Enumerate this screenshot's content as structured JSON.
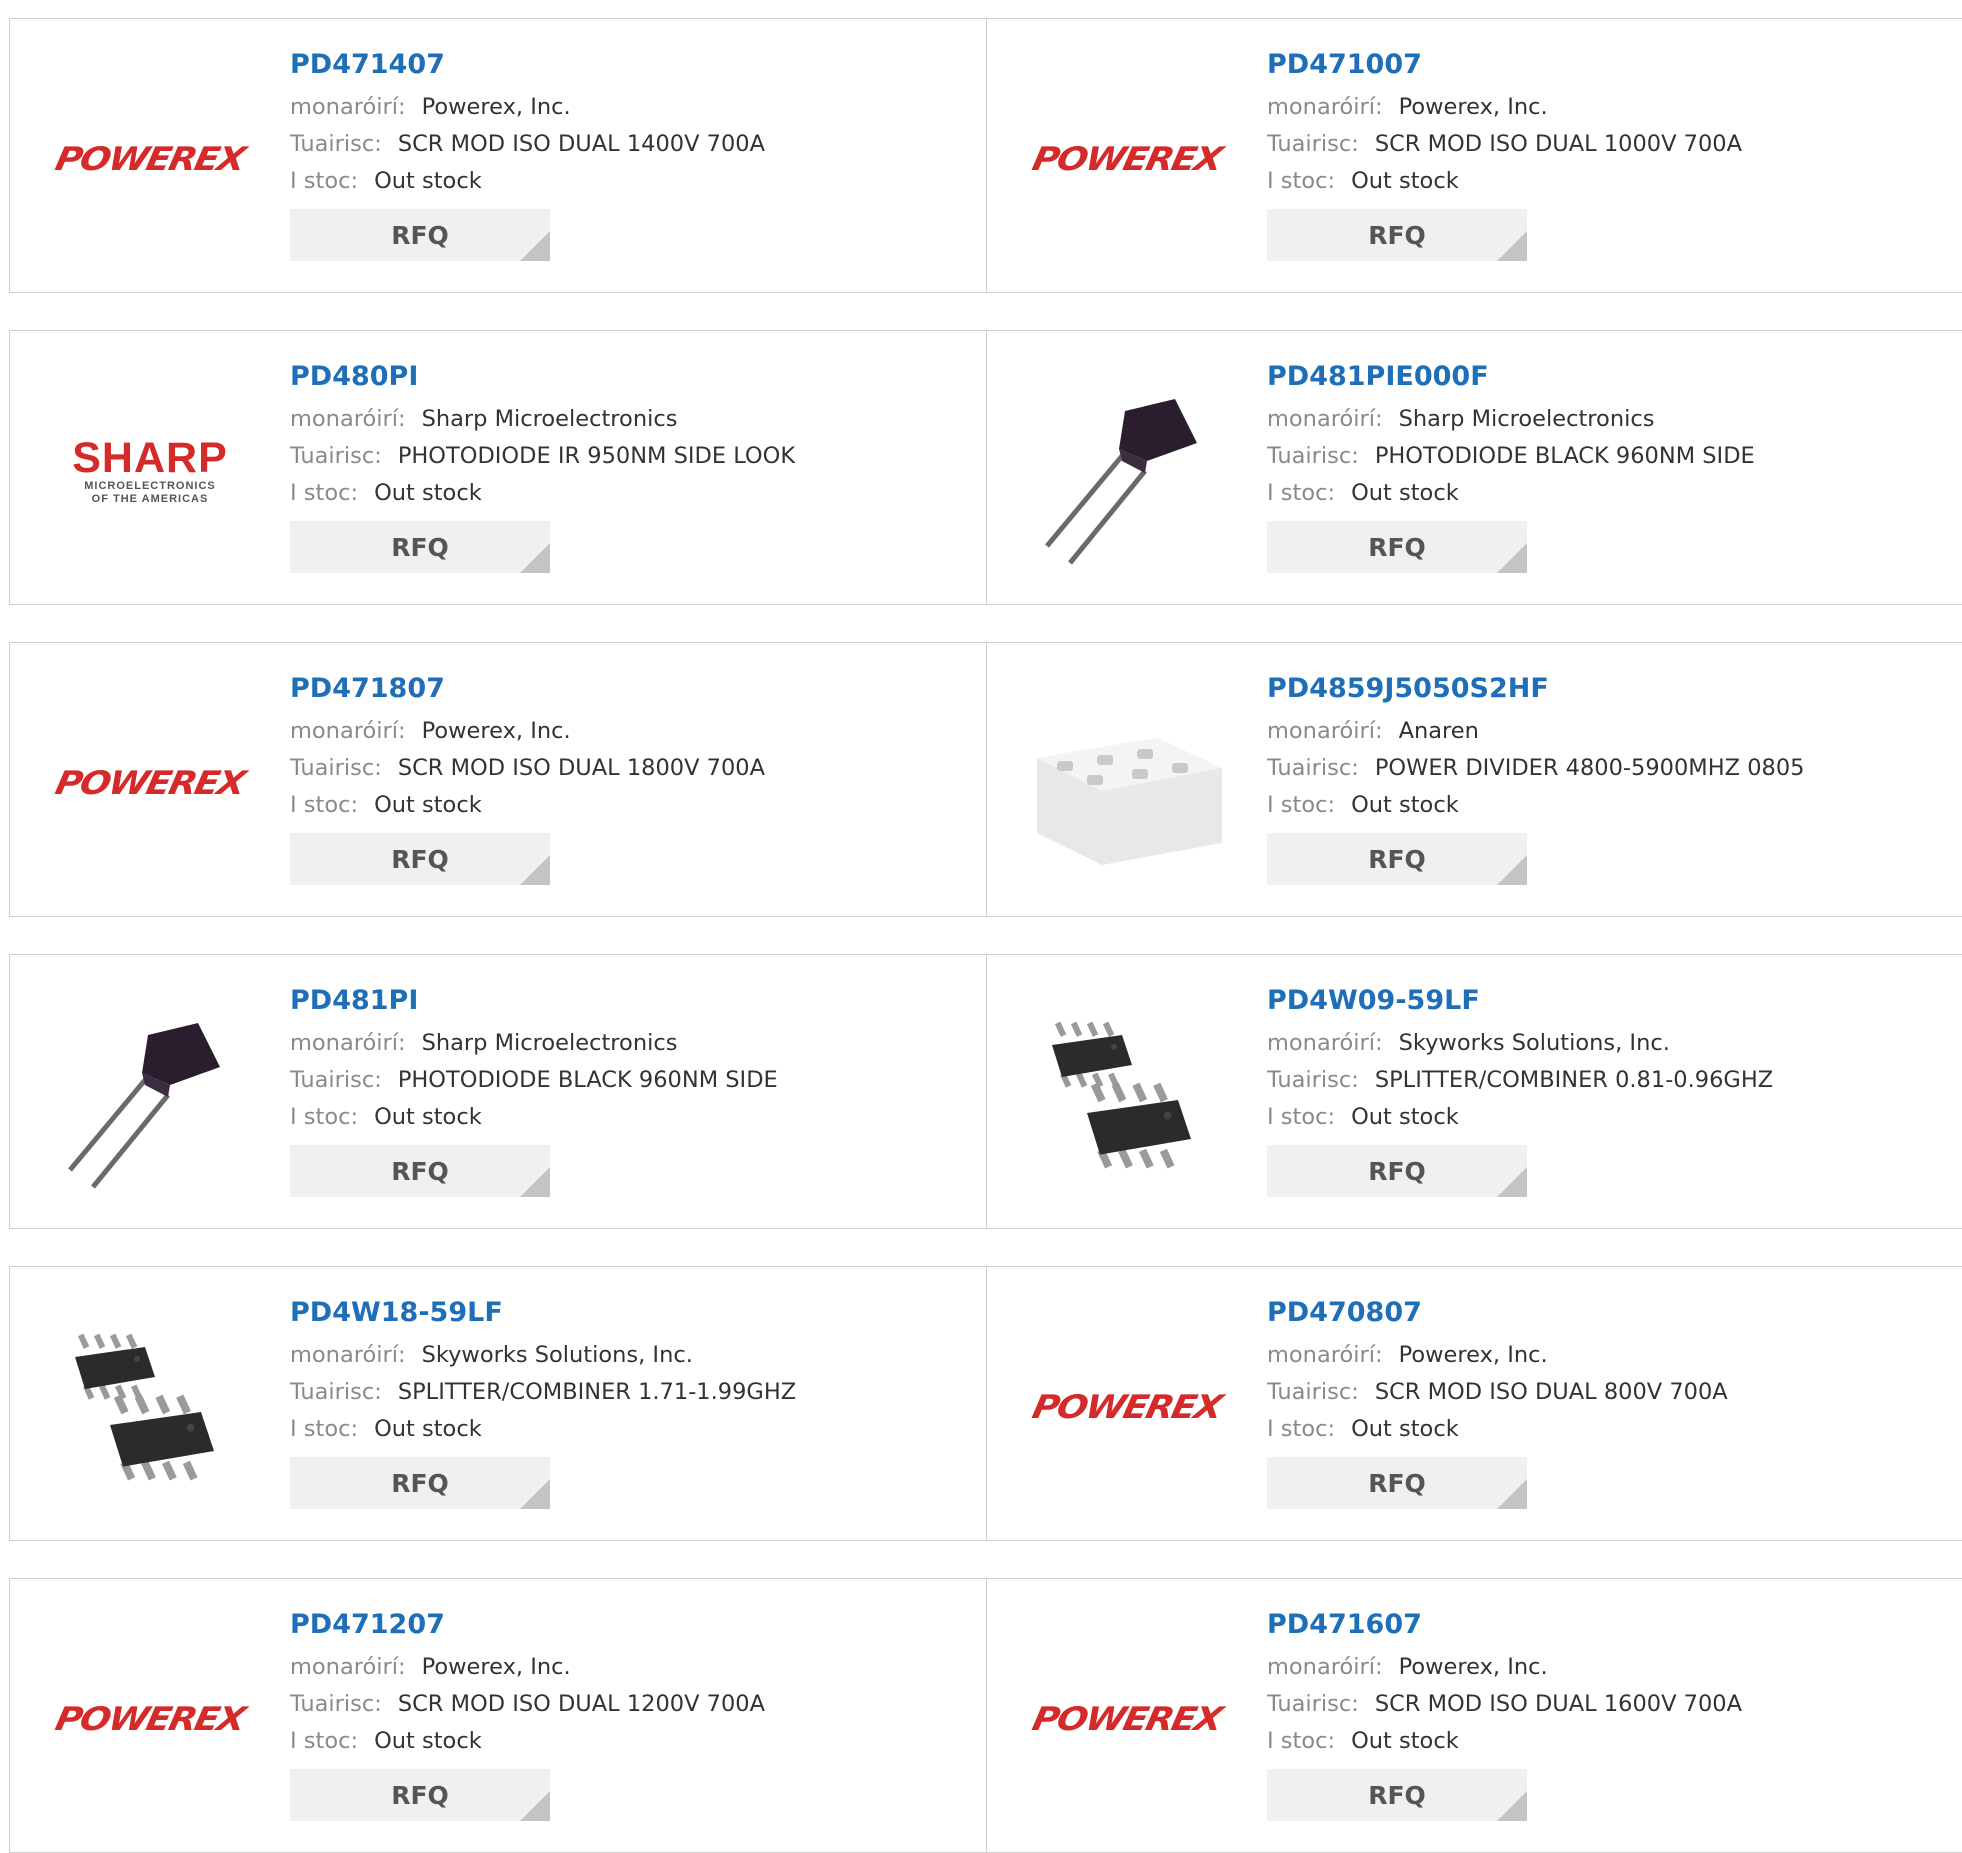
{
  "labels": {
    "manufacturer": "monaróirí:",
    "description": "Tuairisc:",
    "stock": "I stoc:"
  },
  "products": [
    {
      "part": "PD471407",
      "manufacturer": "Powerex, Inc.",
      "description": "SCR MOD ISO DUAL 1400V 700A",
      "stock": "Out stock",
      "rfq": "RFQ",
      "image": "powerex-logo"
    },
    {
      "part": "PD471007",
      "manufacturer": "Powerex, Inc.",
      "description": "SCR MOD ISO DUAL 1000V 700A",
      "stock": "Out stock",
      "rfq": "RFQ",
      "image": "powerex-logo"
    },
    {
      "part": "PD480PI",
      "manufacturer": "Sharp Microelectronics",
      "description": "PHOTODIODE IR 950NM SIDE LOOK",
      "stock": "Out stock",
      "rfq": "RFQ",
      "image": "sharp-logo"
    },
    {
      "part": "PD481PIE000F",
      "manufacturer": "Sharp Microelectronics",
      "description": "PHOTODIODE BLACK 960NM SIDE",
      "stock": "Out stock",
      "rfq": "RFQ",
      "image": "photodiode-image"
    },
    {
      "part": "PD471807",
      "manufacturer": "Powerex, Inc.",
      "description": "SCR MOD ISO DUAL 1800V 700A",
      "stock": "Out stock",
      "rfq": "RFQ",
      "image": "powerex-logo"
    },
    {
      "part": "PD4859J5050S2HF",
      "manufacturer": "Anaren",
      "description": "POWER DIVIDER 4800-5900MHZ 0805",
      "stock": "Out stock",
      "rfq": "RFQ",
      "image": "chip-package-image"
    },
    {
      "part": "PD481PI",
      "manufacturer": "Sharp Microelectronics",
      "description": "PHOTODIODE BLACK 960NM SIDE",
      "stock": "Out stock",
      "rfq": "RFQ",
      "image": "photodiode-image"
    },
    {
      "part": "PD4W09-59LF",
      "manufacturer": "Skyworks Solutions, Inc.",
      "description": "SPLITTER/COMBINER 0.81-0.96GHZ",
      "stock": "Out stock",
      "rfq": "RFQ",
      "image": "msop-ic-image"
    },
    {
      "part": "PD4W18-59LF",
      "manufacturer": "Skyworks Solutions, Inc.",
      "description": "SPLITTER/COMBINER 1.71-1.99GHZ",
      "stock": "Out stock",
      "rfq": "RFQ",
      "image": "msop-ic-image"
    },
    {
      "part": "PD470807",
      "manufacturer": "Powerex, Inc.",
      "description": "SCR MOD ISO DUAL 800V 700A",
      "stock": "Out stock",
      "rfq": "RFQ",
      "image": "powerex-logo"
    },
    {
      "part": "PD471207",
      "manufacturer": "Powerex, Inc.",
      "description": "SCR MOD ISO DUAL 1200V 700A",
      "stock": "Out stock",
      "rfq": "RFQ",
      "image": "powerex-logo"
    },
    {
      "part": "PD471607",
      "manufacturer": "Powerex, Inc.",
      "description": "SCR MOD ISO DUAL 1600V 700A",
      "stock": "Out stock",
      "rfq": "RFQ",
      "image": "powerex-logo"
    }
  ],
  "logos": {
    "powerex": "POWEREX",
    "sharp": "SHARP",
    "sharp_sub_1": "MICROELECTRONICS",
    "sharp_sub_2": "OF THE AMERICAS"
  },
  "colors": {
    "link": "#1e6fb8",
    "brand_red": "#d42a2a",
    "button_bg": "#f0f0f0",
    "border": "#cfcfcf"
  }
}
